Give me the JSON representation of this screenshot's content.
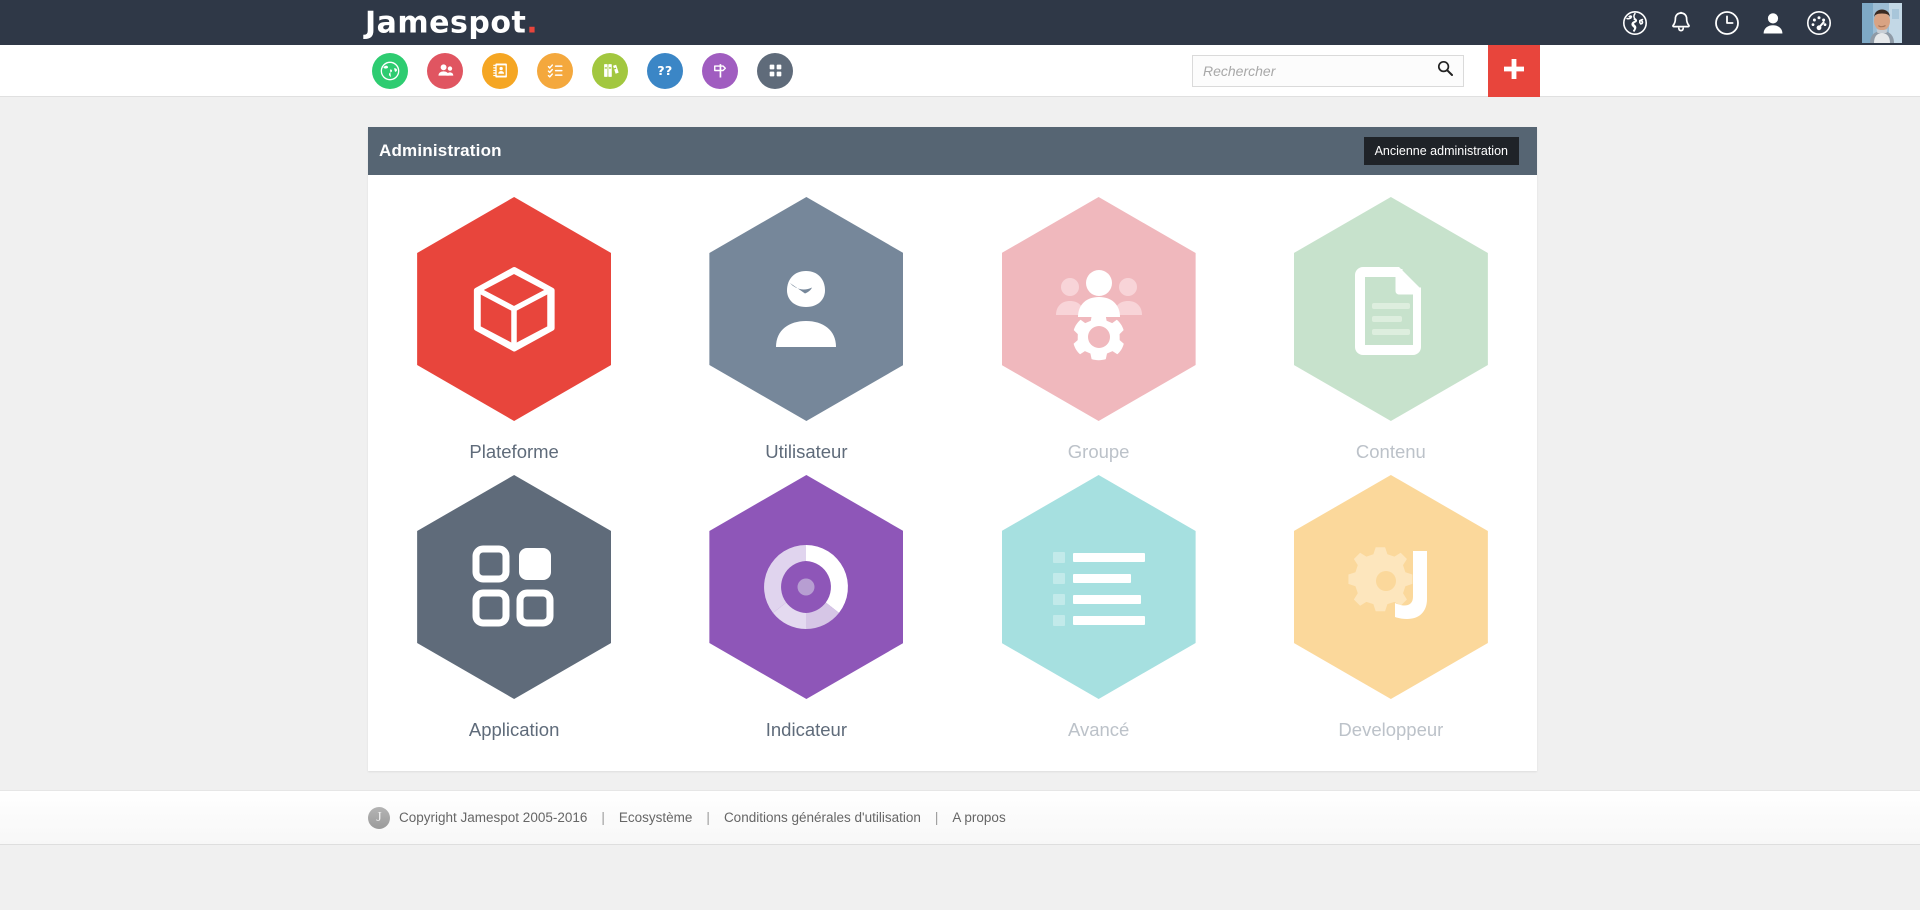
{
  "topbar": {
    "logo_text": "Jamespot",
    "logo_dot": ".",
    "icons": [
      {
        "name": "globe-icon",
        "label": "Réseau"
      },
      {
        "name": "bell-icon",
        "label": "Notifications"
      },
      {
        "name": "clock-icon",
        "label": "Activité récente"
      },
      {
        "name": "user-icon",
        "label": "Profil"
      },
      {
        "name": "dashboard-icon",
        "label": "Tableau de bord"
      }
    ],
    "avatar_alt": "Photo de profil"
  },
  "subnav": {
    "apps": [
      {
        "name": "app-globe",
        "label": "Réseau",
        "color": "#2ecc71"
      },
      {
        "name": "app-people",
        "label": "Annuaire",
        "color": "#e05561"
      },
      {
        "name": "app-notebook",
        "label": "Carnet",
        "color": "#f5a623"
      },
      {
        "name": "app-checklist",
        "label": "Tâches",
        "color": "#f4a83d"
      },
      {
        "name": "app-books",
        "label": "Bibliothèque",
        "color": "#a2c73f"
      },
      {
        "name": "app-faq",
        "label": "Questions",
        "color": "#3b86c6"
      },
      {
        "name": "app-signpost",
        "label": "Orientation",
        "color": "#a05dc0"
      },
      {
        "name": "app-grid",
        "label": "Applications",
        "color": "#5f6b7a"
      }
    ],
    "search": {
      "placeholder": "Rechercher",
      "value": "",
      "icon": "search-icon"
    },
    "add_button": {
      "name": "add-button",
      "icon": "plus-icon",
      "color": "#e8453c"
    }
  },
  "card": {
    "title": "Administration",
    "header_color": "#566573",
    "old_admin_button": "Ancienne administration",
    "tiles": [
      {
        "label": "Plateforme",
        "icon": "cube-icon",
        "color": "#e8453c",
        "enabled": true
      },
      {
        "label": "Utilisateur",
        "icon": "person-icon",
        "color": "#76879a",
        "enabled": true
      },
      {
        "label": "Groupe",
        "icon": "group-gear-icon",
        "color": "#f0b8bd",
        "enabled": false
      },
      {
        "label": "Contenu",
        "icon": "document-icon",
        "color": "#c7e2cc",
        "enabled": false
      },
      {
        "label": "Application",
        "icon": "grid-icon",
        "color": "#5f6b7a",
        "enabled": true
      },
      {
        "label": "Indicateur",
        "icon": "donut-icon",
        "color": "#8e56b8",
        "enabled": true
      },
      {
        "label": "Avancé",
        "icon": "list-icon",
        "color": "#a6e0e0",
        "enabled": false
      },
      {
        "label": "Developpeur",
        "icon": "gear-j-icon",
        "color": "#fbd89b",
        "enabled": false
      }
    ]
  },
  "footer": {
    "logo": "J",
    "copyright": "Copyright Jamespot 2005-2016",
    "sep": "|",
    "links": [
      {
        "label": "Ecosystème"
      },
      {
        "label": "Conditions générales d'utilisation"
      },
      {
        "label": "A propos"
      }
    ]
  }
}
